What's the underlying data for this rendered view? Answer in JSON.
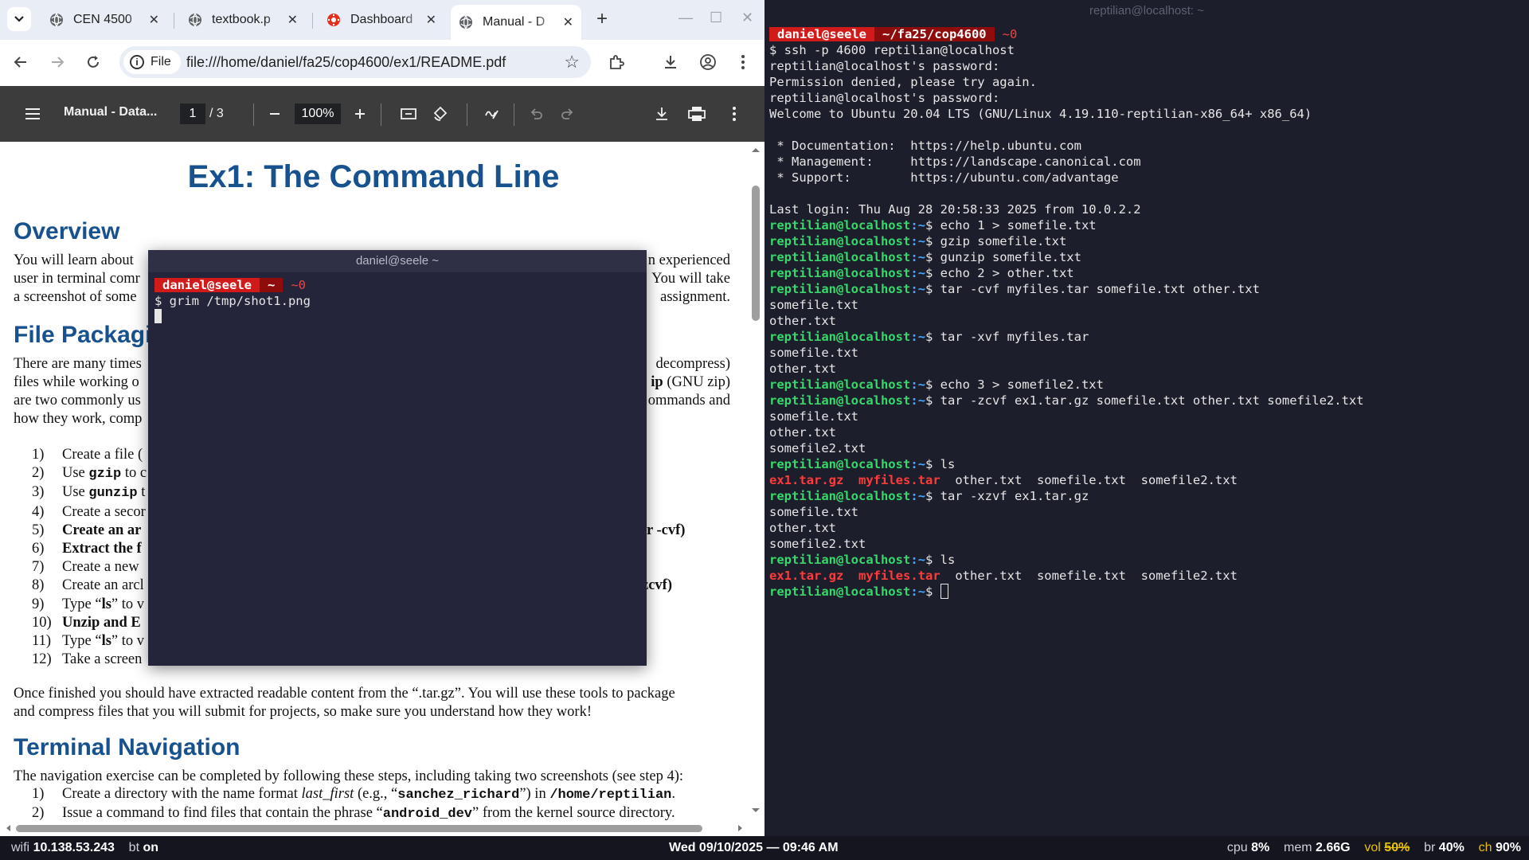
{
  "browser": {
    "tabs": [
      {
        "title": "CEN 4500",
        "close": "✕"
      },
      {
        "title": "textbook.p",
        "close": "✕"
      },
      {
        "title": "Dashboard",
        "close": "✕"
      },
      {
        "title": "Manual - D",
        "close": "✕"
      }
    ],
    "new_tab": "+",
    "chip_label": "File",
    "url": "file:///home/daniel/fa25/cop4600/ex1/README.pdf"
  },
  "pdf_toolbar": {
    "title": "Manual - Data...",
    "page": "1",
    "total": "/  3",
    "zoom": "100%"
  },
  "doc": {
    "title": "Ex1: The Command Line",
    "overview_heading": "Overview",
    "overview_lines": [
      {
        "left": "You will learn about",
        "right": "n experienced"
      },
      {
        "left": "user in terminal comr",
        "right": "You will take"
      },
      {
        "left": "a screenshot of some",
        "right": "assignment."
      }
    ],
    "packaging_heading": "File Packagi",
    "packaging_lines": [
      {
        "left": "There are many times",
        "right": "decompress)"
      },
      {
        "left": "files while working o",
        "right_bold": "ip",
        "right": " (GNU zip)"
      },
      {
        "left": "are two commonly us",
        "right": "ommands and"
      },
      {
        "left": "how they work, comp",
        "right": ""
      }
    ],
    "steps": [
      {
        "n": "1)",
        "pre": "Create a file (",
        "tool": "",
        "post": "",
        "right": ""
      },
      {
        "n": "2)",
        "pre": "Use ",
        "tool": "gzip",
        "post": " to c",
        "right": ""
      },
      {
        "n": "3)",
        "pre": "Use ",
        "tool": "gunzip",
        "post": " t",
        "right": ""
      },
      {
        "n": "4)",
        "pre": "Create a secor",
        "tool": "",
        "post": "",
        "right": ""
      },
      {
        "n": "5)",
        "pre": "",
        "bold": "Create an ar",
        "right": "r -cvf)"
      },
      {
        "n": "6)",
        "pre": "",
        "bold": "Extract the f",
        "right": ""
      },
      {
        "n": "7)",
        "pre": "Create a new",
        "tool": "",
        "post": "",
        "right": ""
      },
      {
        "n": "8)",
        "pre": "Create an arcl",
        "tool": "",
        "post": "",
        "right": "zcvf)"
      },
      {
        "n": "9)",
        "pre": "Type “",
        "bold_inline": "ls",
        "post": "” to v",
        "right": ""
      },
      {
        "n": "10)",
        "pre": "",
        "bold": "Unzip and E",
        "right": ""
      },
      {
        "n": "11)",
        "pre": "Type “",
        "bold_inline": "ls",
        "post": "” to v",
        "right": ""
      },
      {
        "n": "12)",
        "pre": "Take a screen",
        "tool": "",
        "post": "",
        "right": ""
      }
    ],
    "finished_para_1": "Once finished you should have extracted readable content from the “.tar.gz”. You will use these tools to package",
    "finished_para_2": "and compress files that you will submit for projects, so make sure you understand how they work!",
    "nav_heading": "Terminal Navigation",
    "nav_para": "The navigation exercise can be completed by following these steps, including taking two screenshots (see step 4):",
    "nav_step1": {
      "n": "1)",
      "a": "Create a directory with the name format ",
      "i": "last_first",
      "b": " (e.g., “",
      "m1": "sanchez_richard",
      "c": "”) in ",
      "m2": "/home/reptilian",
      "d": "."
    },
    "nav_step2": {
      "n": "2)",
      "a": "Issue a command to find files that contain the phrase “",
      "m1": "android_dev",
      "b": "” from the kernel source directory."
    }
  },
  "float_term": {
    "title": "daniel@seele ~",
    "user": "daniel@seele",
    "dir": "~",
    "code": "~0",
    "cmd": "$ grim /tmp/shot1.png"
  },
  "right_term": {
    "title": "reptilian@localhost: ~",
    "user": "daniel@seele",
    "dir": "~/fa25/cop4600",
    "code": "~0",
    "prompt_user": "reptilian@localhost",
    "prompt_path": ":~",
    "lines": {
      "l1": "$ ssh -p 4600 reptilian@localhost",
      "l2": "reptilian@localhost's password:",
      "l3": "Permission denied, please try again.",
      "l4": "reptilian@localhost's password:",
      "l5": "Welcome to Ubuntu 20.04 LTS (GNU/Linux 4.19.110-reptilian-x86_64+ x86_64)",
      "l6": " * Documentation:  https://help.ubuntu.com",
      "l7": " * Management:     https://landscape.canonical.com",
      "l8": " * Support:        https://ubuntu.com/advantage",
      "l9": "Last login: Thu Aug 28 20:58:33 2025 from 10.0.2.2",
      "c1": "$ echo 1 > somefile.txt",
      "c2": "$ gzip somefile.txt",
      "c3": "$ gunzip somefile.txt",
      "c4": "$ echo 2 > other.txt",
      "c5": "$ tar -cvf myfiles.tar somefile.txt other.txt",
      "o5a": "somefile.txt",
      "o5b": "other.txt",
      "c6": "$ tar -xvf myfiles.tar",
      "o6a": "somefile.txt",
      "o6b": "other.txt",
      "c7": "$ echo 3 > somefile2.txt",
      "c8": "$ tar -zcvf ex1.tar.gz somefile.txt other.txt somefile2.txt",
      "o8a": "somefile.txt",
      "o8b": "other.txt",
      "o8c": "somefile2.txt",
      "c9": "$ ls",
      "ls1_red1": "ex1.tar.gz",
      "ls1_red2": "myfiles.tar",
      "ls1_rest": "  other.txt  somefile.txt  somefile2.txt",
      "c10": "$ tar -xzvf ex1.tar.gz",
      "o10a": "somefile.txt",
      "o10b": "other.txt",
      "o10c": "somefile2.txt",
      "c11": "$ ls",
      "ls2_red1": "ex1.tar.gz",
      "ls2_red2": "myfiles.tar",
      "ls2_rest": "  other.txt  somefile.txt  somefile2.txt",
      "c12": "$ "
    }
  },
  "statusbar": {
    "wifi_label": "wifi",
    "wifi_ip": "10.138.53.243",
    "bt_label": "bt",
    "bt_value": "on",
    "datetime": "Wed 09/10/2025 — 09:46 AM",
    "cpu_label": "cpu",
    "cpu_value": "8%",
    "mem_label": "mem",
    "mem_value": "2.66G",
    "vol_label": "vol",
    "vol_value": "50%",
    "br_label": "br",
    "br_value": "40%",
    "ch_label": "ch",
    "ch_value": "90%"
  },
  "colors": {
    "doc_heading": "#18528e",
    "prompt_green": "#36d96a",
    "prompt_blue": "#4aa8ff",
    "archive_red": "#ff3b3b",
    "powerline_red": "#d11a1a"
  },
  "icons": [
    "tab-list-icon",
    "chrome-icon",
    "canvas-icon",
    "back-icon",
    "forward-icon",
    "reload-icon",
    "info-icon",
    "star-icon",
    "extensions-icon",
    "download-icon",
    "profile-icon",
    "menu-icon",
    "sidebar-icon",
    "zoom-out-icon",
    "zoom-in-icon",
    "fit-icon",
    "rotate-icon",
    "draw-icon",
    "undo-icon",
    "redo-icon",
    "print-icon",
    "more-icon"
  ]
}
